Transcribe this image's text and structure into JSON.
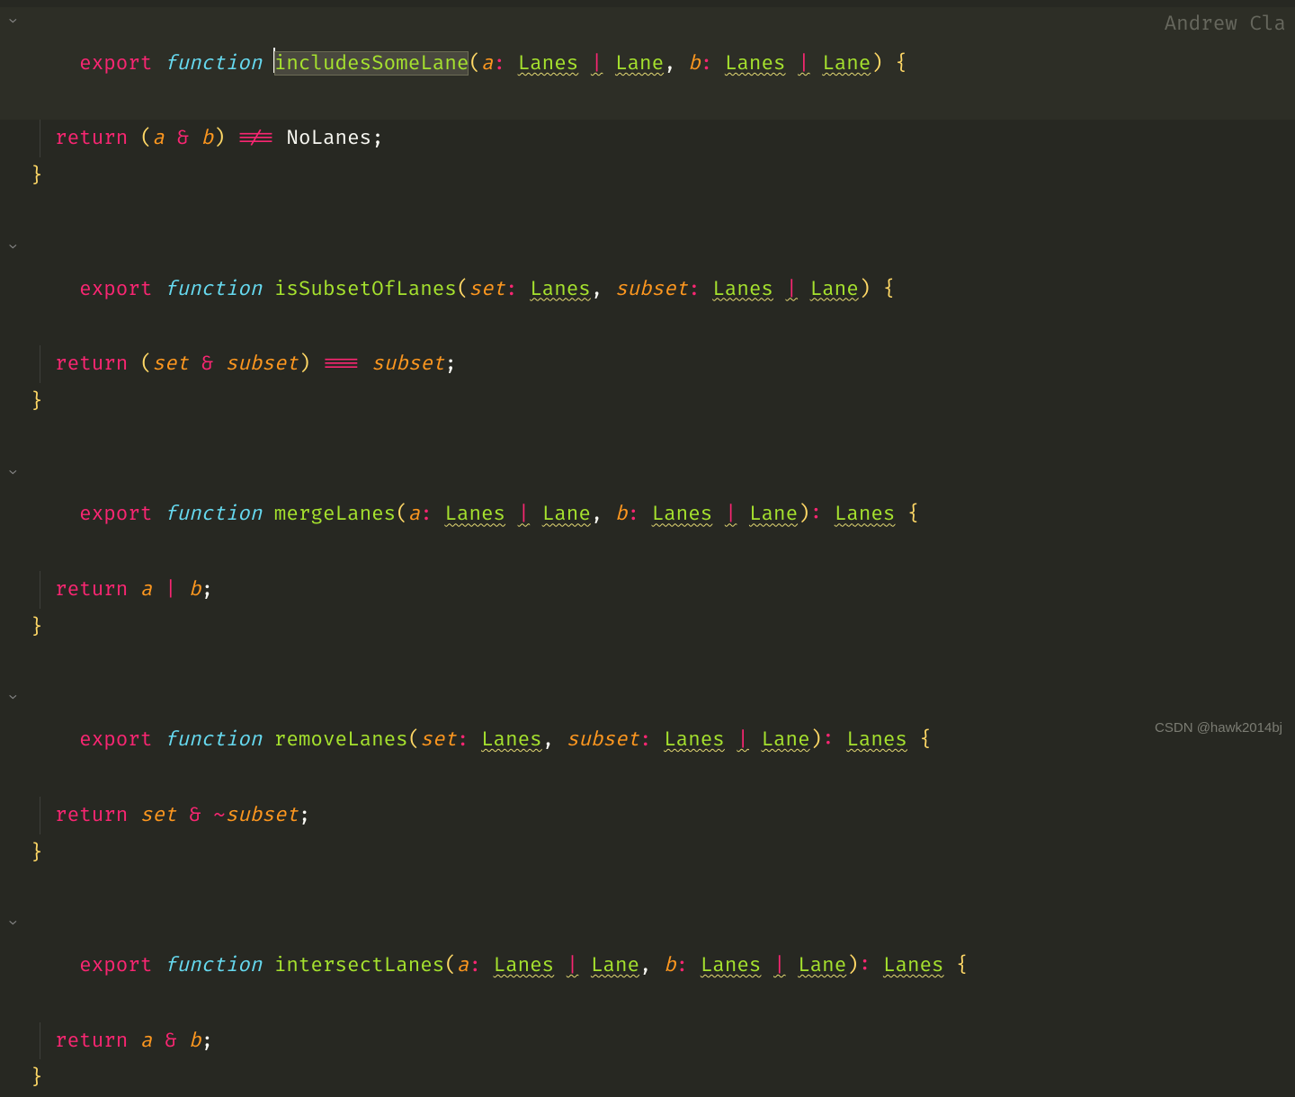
{
  "blame": "Andrew Cla",
  "watermark": "CSDN @hawk2014bj",
  "tokens": {
    "export": "export",
    "function": "function",
    "return": "return"
  },
  "fns": [
    {
      "name": "includesSomeLane",
      "sig": {
        "p1": "a",
        "t1a": "Lanes",
        "t1b": "Lane",
        "p2": "b",
        "t2a": "Lanes",
        "t2b": "Lane",
        "ret": null
      },
      "body": {
        "lhs_open": "(",
        "lhs1": "a",
        "op1": "&",
        "lhs2": "b",
        "lhs_close": ")",
        "op2": "!==",
        "rhs": "NoLanes"
      }
    },
    {
      "name": "isSubsetOfLanes",
      "sig": {
        "p1": "set",
        "t1a": "Lanes",
        "t1b": null,
        "p2": "subset",
        "t2a": "Lanes",
        "t2b": "Lane",
        "ret": null
      },
      "body": {
        "lhs_open": "(",
        "lhs1": "set",
        "op1": "&",
        "lhs2": "subset",
        "lhs_close": ")",
        "op2": "===",
        "rhs": "subset"
      }
    },
    {
      "name": "mergeLanes",
      "sig": {
        "p1": "a",
        "t1a": "Lanes",
        "t1b": "Lane",
        "p2": "b",
        "t2a": "Lanes",
        "t2b": "Lane",
        "ret": "Lanes"
      },
      "body": {
        "lhs_open": "",
        "lhs1": "a",
        "op1": "|",
        "lhs2": "b",
        "lhs_close": "",
        "op2": null,
        "rhs": null
      }
    },
    {
      "name": "removeLanes",
      "sig": {
        "p1": "set",
        "t1a": "Lanes",
        "t1b": null,
        "p2": "subset",
        "t2a": "Lanes",
        "t2b": "Lane",
        "ret": "Lanes"
      },
      "body": {
        "lhs_open": "",
        "lhs1": "set",
        "op1": "&",
        "pre2": "~",
        "lhs2": "subset",
        "lhs_close": "",
        "op2": null,
        "rhs": null
      }
    },
    {
      "name": "intersectLanes",
      "sig": {
        "p1": "a",
        "t1a": "Lanes",
        "t1b": "Lane",
        "p2": "b",
        "t2a": "Lanes",
        "t2b": "Lane",
        "ret": "Lanes"
      },
      "body": {
        "lhs_open": "",
        "lhs1": "a",
        "op1": "&",
        "lhs2": "b",
        "lhs_close": "",
        "op2": null,
        "rhs": null
      }
    }
  ]
}
